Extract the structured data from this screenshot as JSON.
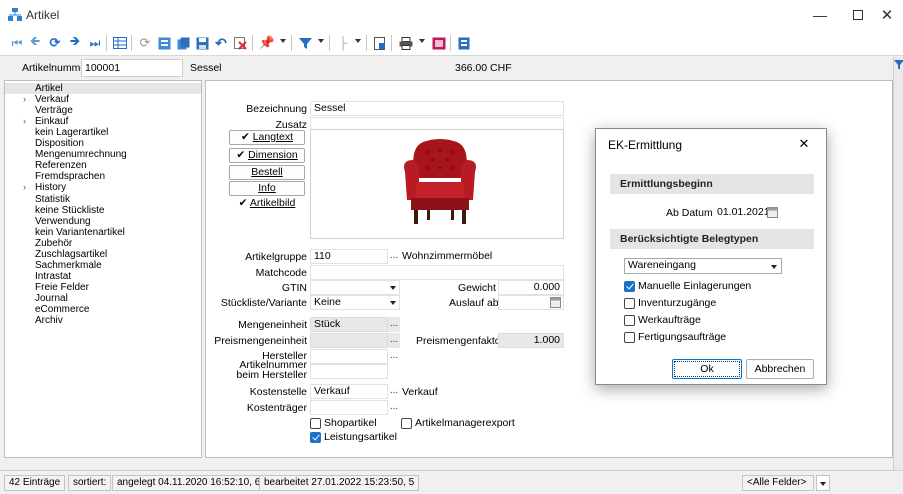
{
  "window": {
    "title": "Artikel"
  },
  "header": {
    "artikelnummer_label": "Artikelnummer",
    "artikelnummer_value": "100001",
    "name": "Sessel",
    "price": "366.00 CHF"
  },
  "nav": {
    "items": [
      {
        "label": "Artikel",
        "expandable": false,
        "selected": true
      },
      {
        "label": "Verkauf",
        "expandable": true
      },
      {
        "label": "Verträge",
        "expandable": false
      },
      {
        "label": "Einkauf",
        "expandable": true
      },
      {
        "label": "kein Lagerartikel",
        "expandable": false
      },
      {
        "label": "Disposition",
        "expandable": false
      },
      {
        "label": "Mengenumrechnung",
        "expandable": false
      },
      {
        "label": "Referenzen",
        "expandable": false
      },
      {
        "label": "Fremdsprachen",
        "expandable": false
      },
      {
        "label": "History",
        "expandable": true
      },
      {
        "label": "Statistik",
        "expandable": false
      },
      {
        "label": "keine Stückliste",
        "expandable": false
      },
      {
        "label": "Verwendung",
        "expandable": false
      },
      {
        "label": "kein Variantenartikel",
        "expandable": false
      },
      {
        "label": "Zubehör",
        "expandable": false
      },
      {
        "label": "Zuschlagsartikel",
        "expandable": false
      },
      {
        "label": "Sachmerkmale",
        "expandable": false
      },
      {
        "label": "Intrastat",
        "expandable": false
      },
      {
        "label": "Freie Felder",
        "expandable": false
      },
      {
        "label": "Journal",
        "expandable": false
      },
      {
        "label": "eCommerce",
        "expandable": false
      },
      {
        "label": "Archiv",
        "expandable": false
      }
    ]
  },
  "form": {
    "bezeichnung_label": "Bezeichnung",
    "bezeichnung_value": "Sessel",
    "zusatz_label": "Zusatz",
    "zusatz_value": "",
    "side_buttons": {
      "langtext": "Langtext",
      "dimension": "Dimension",
      "bestell": "Bestell",
      "info": "Info",
      "artikelbild": "Artikelbild"
    },
    "artikelgruppe_label": "Artikelgruppe",
    "artikelgruppe_value": "110",
    "artikelgruppe_text": "Wohnzimmermöbel",
    "matchcode_label": "Matchcode",
    "gtin_label": "GTIN",
    "gewicht_label": "Gewicht",
    "gewicht_value": "0.000",
    "stueckliste_label": "Stückliste/Variante",
    "stueckliste_value": "Keine",
    "auslauf_label": "Auslauf ab",
    "mengeneinheit_label": "Mengeneinheit",
    "mengeneinheit_value": "Stück",
    "preismengeneinheit_label": "Preismengeneinheit",
    "preismengenfaktor_label": "Preismengenfaktor",
    "preismengenfaktor_value": "1.000",
    "hersteller_label": "Hersteller",
    "artikelnummer_hersteller_label_1": "Artikelnummer",
    "artikelnummer_hersteller_label_2": "beim Hersteller",
    "kostenstelle_label": "Kostenstelle",
    "kostenstelle_value": "Verkauf",
    "kostenstelle_text": "Verkauf",
    "kostentraeger_label": "Kostenträger",
    "shopartikel_label": "Shopartikel",
    "artikelmanagerexport_label": "Artikelmanagerexport",
    "leistungsartikel_label": "Leistungsartikel",
    "dots": "..."
  },
  "dialog": {
    "title": "EK-Ermittlung",
    "section1": "Ermittlungsbeginn",
    "ab_datum_label": "Ab Datum",
    "ab_datum_value": "01.01.2021",
    "section2": "Berücksichtigte Belegtypen",
    "belegtyp_value": "Wareneingang",
    "options": [
      {
        "label": "Manuelle Einlagerungen",
        "checked": true
      },
      {
        "label": "Inventurzugänge",
        "checked": false
      },
      {
        "label": "Werkaufträge",
        "checked": false
      },
      {
        "label": "Fertigungsaufträge",
        "checked": false
      }
    ],
    "ok_label": "Ok",
    "cancel_label": "Abbrechen"
  },
  "status": {
    "count": "42 Einträge",
    "sorted": "sortiert:",
    "created": "angelegt 04.11.2020 16:52:10, 6",
    "edited": "bearbeitet 27.01.2022 15:23:50, 5",
    "filter": "<Alle Felder>"
  },
  "colors": {
    "accent": "#1a73c8",
    "selection": "#e6e6e6"
  }
}
